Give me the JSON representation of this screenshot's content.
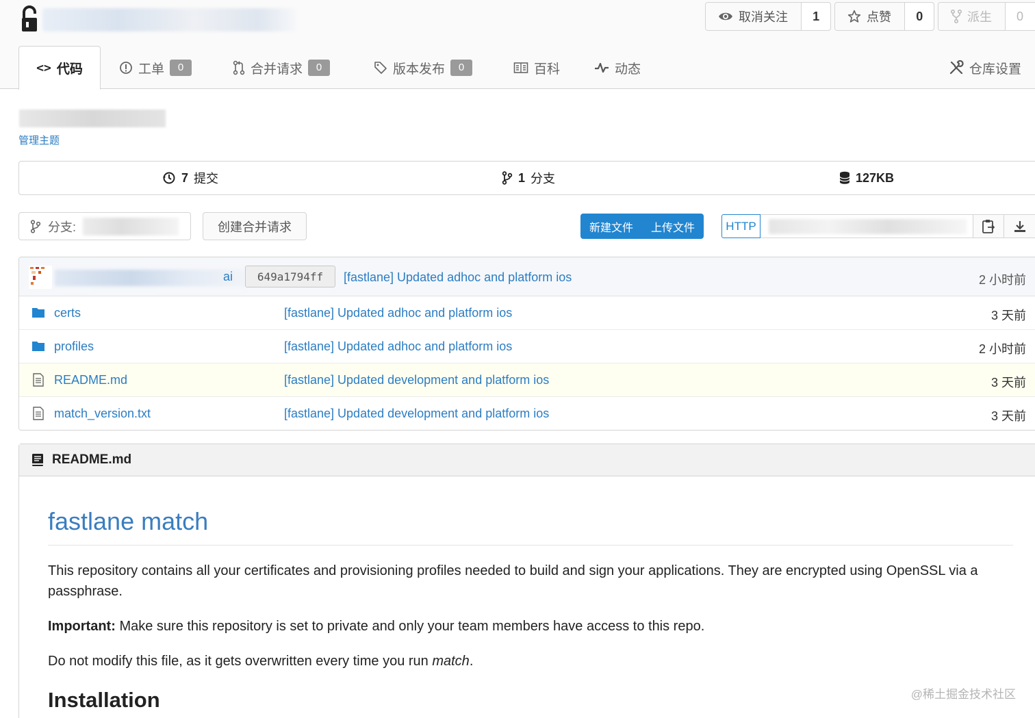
{
  "header": {
    "watch": {
      "label": "取消关注",
      "count": "1"
    },
    "star": {
      "label": "点赞",
      "count": "0"
    },
    "fork": {
      "label": "派生",
      "count": "0"
    }
  },
  "tabs": [
    {
      "label": "代码",
      "icon": "code-icon"
    },
    {
      "label": "工单",
      "badge": "0",
      "icon": "alert-circle-icon"
    },
    {
      "label": "合并请求",
      "badge": "0",
      "icon": "pull-request-icon"
    },
    {
      "label": "版本发布",
      "badge": "0",
      "icon": "tag-icon"
    },
    {
      "label": "百科",
      "icon": "book-icon"
    },
    {
      "label": "动态",
      "icon": "pulse-icon"
    },
    {
      "label": "仓库设置",
      "icon": "tools-icon"
    }
  ],
  "description": {
    "manage_topics": "管理主题"
  },
  "stats": {
    "commits_num": "7",
    "commits_label": "提交",
    "branches_num": "1",
    "branches_label": "分支",
    "size": "127KB"
  },
  "toolbar": {
    "branch_label": "分支:",
    "create_pr": "创建合并请求",
    "new_file": "新建文件",
    "upload_file": "上传文件",
    "protocol": "HTTP"
  },
  "latest_commit": {
    "author_tail": "ai",
    "sha": "649a1794ff",
    "message": "[fastlane] Updated adhoc and platform ios",
    "time": "2 小时前"
  },
  "files": [
    {
      "name": "certs",
      "type": "folder",
      "message": "[fastlane] Updated adhoc and platform ios",
      "time": "3 天前"
    },
    {
      "name": "profiles",
      "type": "folder",
      "message": "[fastlane] Updated adhoc and platform ios",
      "time": "2 小时前"
    },
    {
      "name": "README.md",
      "type": "file",
      "message": "[fastlane] Updated development and platform ios",
      "time": "3 天前"
    },
    {
      "name": "match_version.txt",
      "type": "file",
      "message": "[fastlane] Updated development and platform ios",
      "time": "3 天前"
    }
  ],
  "readme": {
    "filename": "README.md",
    "title": "fastlane match",
    "p1": "This repository contains all your certificates and provisioning profiles needed to build and sign your applications. They are encrypted using OpenSSL via a passphrase.",
    "p2_bold": "Important:",
    "p2_rest": " Make sure this repository is set to private and only your team members have access to this repo.",
    "p3_start": "Do not modify this file, as it gets overwritten every time you run ",
    "p3_em": "match",
    "p3_end": ".",
    "h2": "Installation"
  },
  "watermark": "@稀土掘金技术社区",
  "colors": {
    "accent": "#2185d0",
    "link": "#2b7dc3",
    "badge": "#9a9a9a",
    "highlight_row": "#fefef1"
  }
}
